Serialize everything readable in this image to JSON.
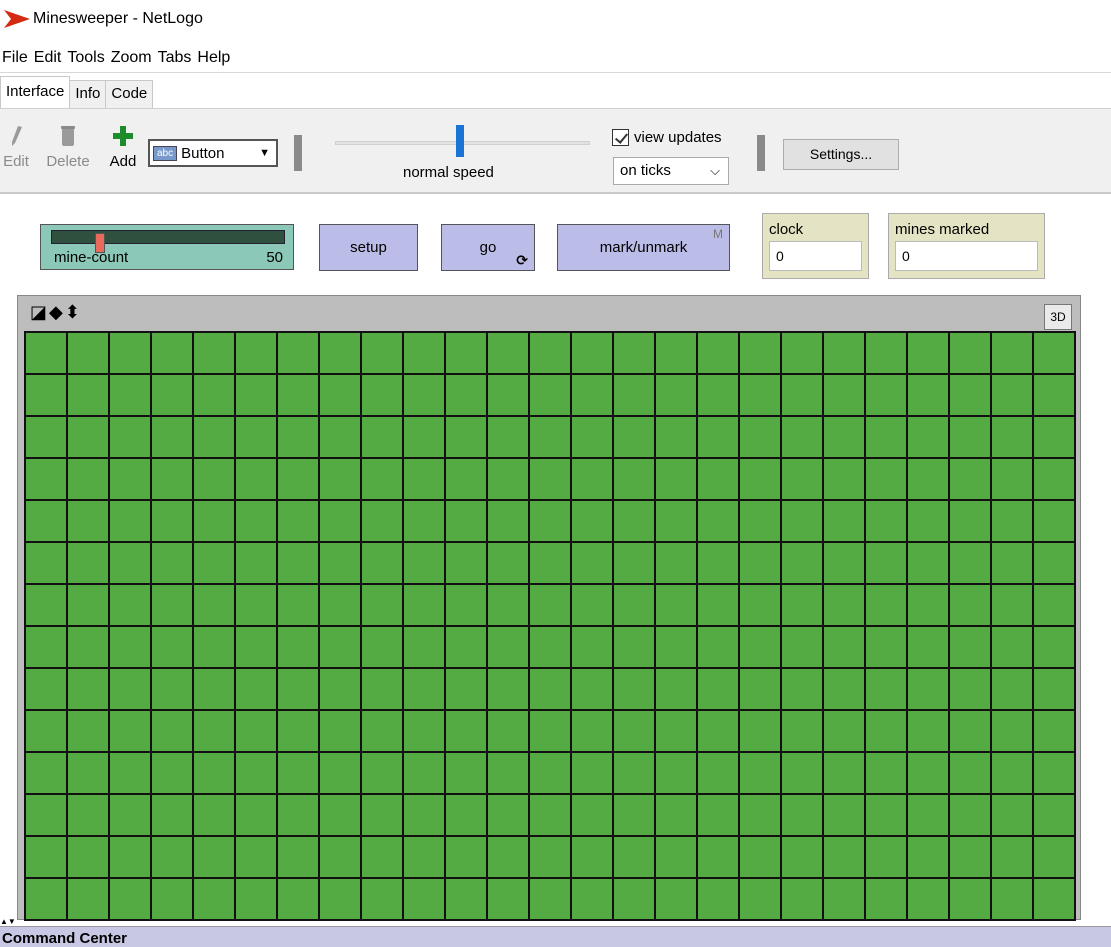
{
  "window": {
    "title": "Minesweeper - NetLogo",
    "icon": "netlogo-red-arrow-icon"
  },
  "menu": [
    "File",
    "Edit",
    "Tools",
    "Zoom",
    "Tabs",
    "Help"
  ],
  "tabs": [
    {
      "label": "Interface",
      "active": true
    },
    {
      "label": "Info",
      "active": false
    },
    {
      "label": "Code",
      "active": false
    }
  ],
  "toolbar": {
    "edit_label": "Edit",
    "delete_label": "Delete",
    "add_label": "Add",
    "widget_type": "Button",
    "speed_label": "normal speed",
    "speed_value": 0.5,
    "view_updates_label": "view updates",
    "view_updates_checked": true,
    "update_mode": "on ticks",
    "settings_label": "Settings..."
  },
  "widgets": {
    "slider": {
      "name": "mine-count",
      "value": "50"
    },
    "setup_button": "setup",
    "go_button": "go",
    "mark_button": "mark/unmark",
    "mark_button_key": "M",
    "clock_monitor": {
      "label": "clock",
      "value": "0"
    },
    "mines_monitor": {
      "label": "mines marked",
      "value": "0"
    }
  },
  "view": {
    "three_d_label": "3D",
    "patch_color": "#55ab43",
    "columns": 25,
    "visible_rows": 14
  },
  "command_center": {
    "label": "Command Center"
  }
}
